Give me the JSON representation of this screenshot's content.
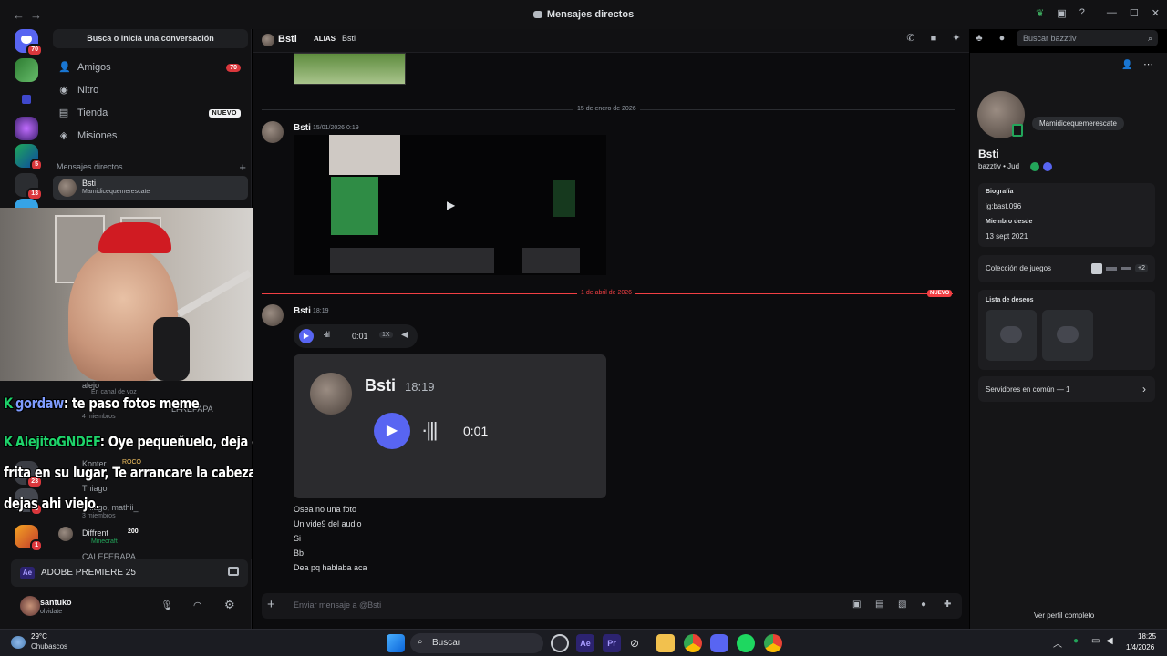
{
  "window": {
    "title": "Mensajes directos"
  },
  "rail": {
    "home_badge": "70",
    "server_badges": [
      "5",
      "13",
      "23",
      "8",
      "1"
    ]
  },
  "sidebar": {
    "search_placeholder": "Busca o inicia una conversación",
    "nav": [
      {
        "label": "Amigos",
        "icon": "friends-icon",
        "badge": "70"
      },
      {
        "label": "Nitro",
        "icon": "nitro-icon"
      },
      {
        "label": "Tienda",
        "icon": "shop-icon",
        "badge_new": "NUEVO"
      },
      {
        "label": "Misiones",
        "icon": "quests-icon"
      }
    ],
    "dm_header": "Mensajes directos",
    "active_dm": {
      "name": "Bsti",
      "status": "Mamidicequemerescate"
    },
    "dim_items": [
      {
        "name": "alejo",
        "sub": "En canal de voz"
      },
      {
        "name": "LFREPAPA",
        "sub": "4 miembros"
      },
      {
        "name": "Konter",
        "tag": "ROCO"
      },
      {
        "name": "Thiago",
        "sub": ""
      },
      {
        "name": "Thiago, mathii_",
        "sub": "3 miembros"
      },
      {
        "name": "Diffrent",
        "tag": "200",
        "sub": "Minecraft"
      },
      {
        "name": "CALEFERAPA",
        "sub": ""
      }
    ]
  },
  "stream_chat": [
    {
      "user": "gordaw",
      "text": ": te paso fotos meme"
    },
    {
      "user": "AlejitoGNDEF",
      "text": ": Oye pequeñuelo, deja esa torta"
    },
    {
      "text": "frita en su lugar, Te arrancare la cabeza si no la"
    },
    {
      "text": "dejas ahi viejo."
    }
  ],
  "activity": {
    "app_icon": "Ae",
    "app_name": "ADOBE PREMIERE 25"
  },
  "user": {
    "name": "santuko",
    "status": "olvidate"
  },
  "header": {
    "name": "Bsti",
    "alias_label": "ALIAS",
    "alias": "Bsti",
    "search_placeholder": "Buscar bazztiv"
  },
  "chat": {
    "date1": "15 de enero de 2026",
    "msg1": {
      "author": "Bsti",
      "timestamp": "15/01/2026 0:19"
    },
    "date2": "1 de abril de 2026",
    "new_badge": "NUEVO",
    "msg2": {
      "author": "Bsti",
      "timestamp": "18:19"
    },
    "voice": {
      "duration": "0:01",
      "speed": "1X"
    },
    "embed": {
      "author": "Bsti",
      "time": "18:19",
      "duration": "0:01"
    },
    "lines": [
      "Osea no una foto",
      "Un vide9 del audio",
      "Si",
      "Bb",
      "Dea pq hablaba aca"
    ],
    "composer_placeholder": "Enviar mensaje a @Bsti"
  },
  "profile": {
    "status_text": "Mamidicequemerescate",
    "display_name": "Bsti",
    "username_line": "bazztiv • Jud",
    "bio_label": "Biografía",
    "bio": "ig:bast.096",
    "member_label": "Miembro desde",
    "member_since": "13 sept 2021",
    "games_label": "Colección de juegos",
    "games_more": "+2",
    "wishlist_label": "Lista de deseos",
    "mutual": "Servidores en común — 1",
    "view_full": "Ver perfil completo"
  },
  "taskbar": {
    "weather_temp": "29°C",
    "weather_desc": "Chubascos",
    "search": "Buscar",
    "time": "18:25",
    "date": "1/4/2026"
  },
  "colors": {
    "accent": "#5865f2",
    "danger": "#da373c",
    "online": "#23a55a"
  }
}
